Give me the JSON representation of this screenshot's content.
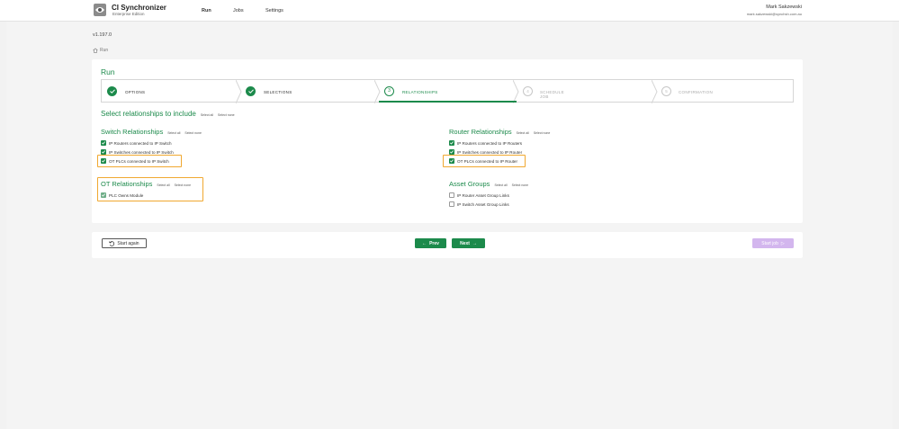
{
  "header": {
    "app_title": "CI Synchronizer",
    "edition": "Enterprise Edition",
    "nav": [
      "Run",
      "Jobs",
      "Settings"
    ],
    "user_name": "Mark Sakzewski",
    "user_email": "mark.sakzewski@synchsh.com.au"
  },
  "version": "v1.197.0",
  "breadcrumb": "Run",
  "card_title": "Run",
  "stepper": {
    "steps": [
      {
        "label": "OPTIONS",
        "state": "done"
      },
      {
        "label": "SELECTIONS",
        "state": "done"
      },
      {
        "label": "RELATIONSHIPS",
        "state": "current",
        "number": "3"
      },
      {
        "label": "SCHEDULE JOB",
        "state": "future",
        "number": "4"
      },
      {
        "label": "CONFIRMATION",
        "state": "future",
        "number": "5"
      }
    ]
  },
  "main_heading": "Select relationships to include",
  "select_all": "Select all",
  "select_none": "Select none",
  "switch": {
    "title": "Switch Relationships",
    "items": [
      {
        "label": "IP Routers connected to IP Switch",
        "checked": true
      },
      {
        "label": "IP Switches connected to IP Switch",
        "checked": true
      },
      {
        "label": "OT PLCs connected to IP Switch",
        "checked": true
      }
    ]
  },
  "router": {
    "title": "Router Relationships",
    "items": [
      {
        "label": "IP Routers connected to IP Routers",
        "checked": true
      },
      {
        "label": "IP Switches connected to IP Router",
        "checked": true
      },
      {
        "label": "OT PLCs connected to IP Router",
        "checked": true
      }
    ]
  },
  "ot": {
    "title": "OT Relationships",
    "items": [
      {
        "label": "PLC Owns Module",
        "checked": true
      }
    ]
  },
  "asset": {
    "title": "Asset Groups",
    "items": [
      {
        "label": "IP Router Asset Group Links",
        "checked": false
      },
      {
        "label": "IP Switch Asset Group Links",
        "checked": false
      }
    ]
  },
  "footer": {
    "start_again": "Start again",
    "prev": "Prev",
    "next": "Next",
    "start_job": "Start job"
  },
  "colors": {
    "accent": "#1c8a4b",
    "highlight": "#f0a830",
    "disabled_button": "#d3b6ee"
  }
}
